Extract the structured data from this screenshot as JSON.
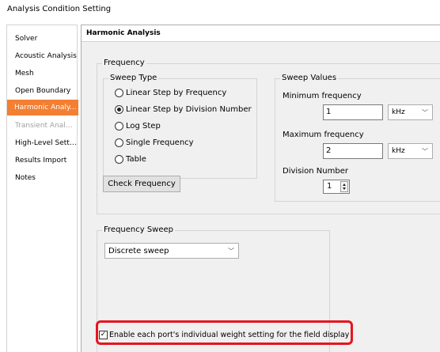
{
  "window": {
    "title": "Analysis Condition Setting"
  },
  "sidebar": {
    "items": [
      {
        "label": "Solver",
        "state": "normal"
      },
      {
        "label": "Acoustic Analysis",
        "state": "normal"
      },
      {
        "label": "Mesh",
        "state": "normal"
      },
      {
        "label": "Open Boundary",
        "state": "normal"
      },
      {
        "label": "Harmonic Analy...",
        "state": "selected"
      },
      {
        "label": "Transient Analysis",
        "state": "disabled"
      },
      {
        "label": "High-Level Setti...",
        "state": "normal"
      },
      {
        "label": "Results Import",
        "state": "normal"
      },
      {
        "label": "Notes",
        "state": "normal"
      }
    ],
    "selected_color": "#f37f33"
  },
  "main": {
    "header": "Harmonic Analysis",
    "frequency_group": {
      "label": "Frequency",
      "sweep_type": {
        "label": "Sweep Type",
        "options": [
          {
            "label": "Linear Step by Frequency",
            "selected": false
          },
          {
            "label": "Linear Step by Division Number",
            "selected": true
          },
          {
            "label": "Log Step",
            "selected": false
          },
          {
            "label": "Single Frequency",
            "selected": false
          },
          {
            "label": "Table",
            "selected": false
          }
        ]
      },
      "check_button": "Check Frequency",
      "sweep_values": {
        "label": "Sweep Values",
        "min_label": "Minimum frequency",
        "min_value": "1",
        "min_unit": "kHz",
        "max_label": "Maximum frequency",
        "max_value": "2",
        "max_unit": "kHz",
        "division_label": "Division Number",
        "division_value": "1"
      }
    },
    "frequency_sweep": {
      "label": "Frequency Sweep",
      "selected": "Discrete sweep"
    },
    "weight_checkbox": {
      "label": "Enable each port's individual weight setting for the field display",
      "checked": true,
      "check_glyph": "✓"
    },
    "highlight_color": "#e8141e"
  },
  "icons": {
    "dropdown": "chevron-down-icon",
    "spin": "spin-arrows-icon"
  }
}
